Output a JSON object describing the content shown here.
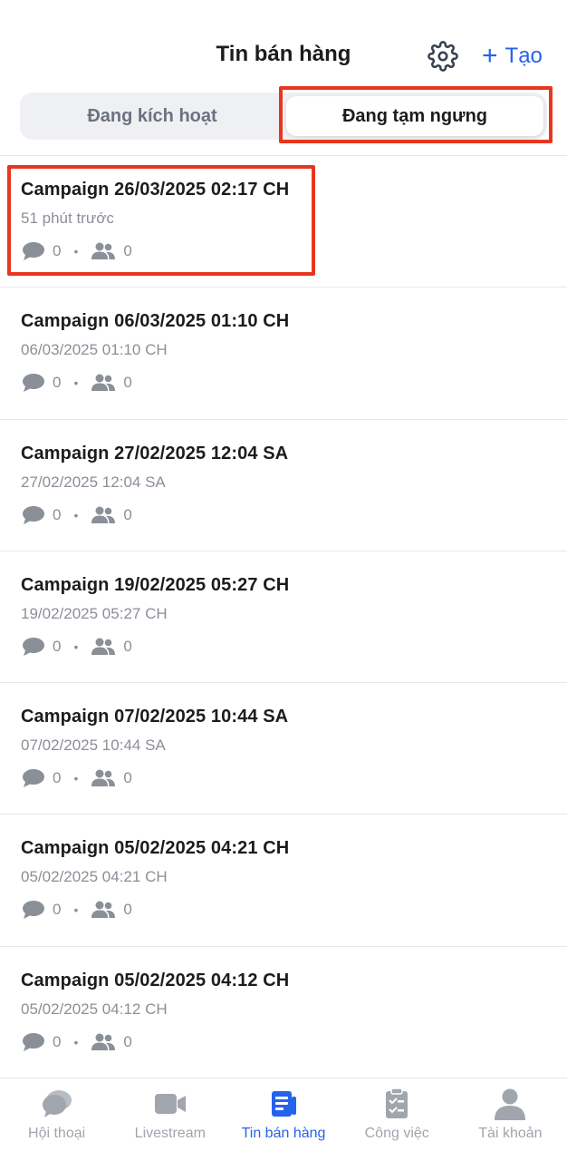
{
  "header": {
    "title": "Tin bán hàng",
    "settings_icon": "gear-icon",
    "create_label": "Tạo",
    "create_icon": "plus-icon"
  },
  "tabs": [
    {
      "label": "Đang kích hoạt",
      "active": false
    },
    {
      "label": "Đang tạm ngưng",
      "active": true
    }
  ],
  "campaigns": [
    {
      "title": "Campaign 26/03/2025 02:17 CH",
      "subtitle": "51 phút trước",
      "comments": "0",
      "members": "0"
    },
    {
      "title": "Campaign 06/03/2025 01:10 CH",
      "subtitle": "06/03/2025 01:10 CH",
      "comments": "0",
      "members": "0"
    },
    {
      "title": "Campaign 27/02/2025 12:04 SA",
      "subtitle": "27/02/2025 12:04 SA",
      "comments": "0",
      "members": "0"
    },
    {
      "title": "Campaign 19/02/2025 05:27 CH",
      "subtitle": "19/02/2025 05:27 CH",
      "comments": "0",
      "members": "0"
    },
    {
      "title": "Campaign 07/02/2025 10:44 SA",
      "subtitle": "07/02/2025 10:44 SA",
      "comments": "0",
      "members": "0"
    },
    {
      "title": "Campaign 05/02/2025 04:21 CH",
      "subtitle": "05/02/2025 04:21 CH",
      "comments": "0",
      "members": "0"
    },
    {
      "title": "Campaign 05/02/2025 04:12 CH",
      "subtitle": "05/02/2025 04:12 CH",
      "comments": "0",
      "members": "0"
    }
  ],
  "stat_separator": "•",
  "bottom_nav": [
    {
      "label": "Hội thoại",
      "icon": "chat-icon",
      "active": false
    },
    {
      "label": "Livestream",
      "icon": "video-camera-icon",
      "active": false
    },
    {
      "label": "Tin bán hàng",
      "icon": "news-icon",
      "active": true
    },
    {
      "label": "Công việc",
      "icon": "clipboard-icon",
      "active": false
    },
    {
      "label": "Tài khoản",
      "icon": "user-icon",
      "active": false
    }
  ],
  "colors": {
    "accent": "#2563eb",
    "highlight": "#e8361e",
    "muted": "#8a8f98",
    "icon_gray": "#9ca3af"
  }
}
